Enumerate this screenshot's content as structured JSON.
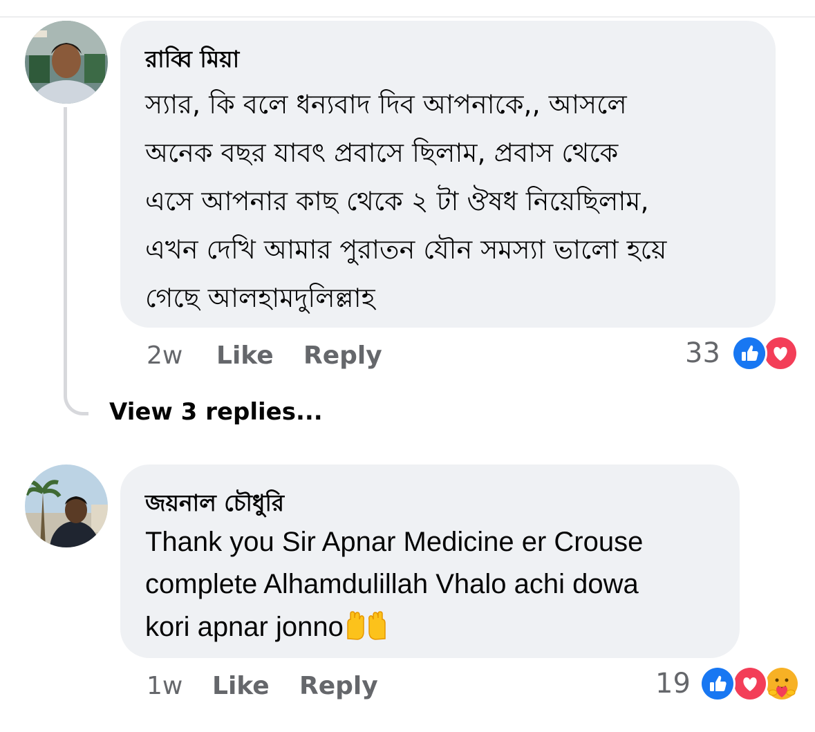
{
  "comments": [
    {
      "author": "রাব্বি মিয়া",
      "lines": [
        "স্যার, কি বলে ধন্যবাদ দিব আপনাকে,, আসলে",
        "অনেক বছর যাবৎ প্রবাসে ছিলাম, প্রবাস থেকে",
        "এসে আপনার কাছ থেকে ২ টা ঔষধ নিয়েছিলাম,",
        "এখন দেখি আমার পুরাতন যৌন সমস্যা ভালো হয়ে",
        "গেছে আলহামদুলিল্লাহ"
      ],
      "time": "2w",
      "like_label": "Like",
      "reply_label": "Reply",
      "reaction_count": "33",
      "reactions": [
        "like-icon",
        "love-icon"
      ],
      "view_replies": "View 3 replies..."
    },
    {
      "author": "জয়নাল চৌধুরি",
      "lines": [
        "Thank you Sir Apnar Medicine er Crouse",
        "complete Alhamdulillah Vhalo achi dowa",
        "kori apnar jonno"
      ],
      "emoji": "raising-hands-emoji",
      "time": "1w",
      "like_label": "Like",
      "reply_label": "Reply",
      "reaction_count": "19",
      "reactions": [
        "like-icon",
        "love-icon",
        "care-icon"
      ]
    }
  ],
  "colors": {
    "bubble": "#eff1f4",
    "meta_text": "#65676b",
    "like_blue": "#1877f2",
    "love_red": "#f33e58",
    "care_yellow": "#f7b125"
  }
}
